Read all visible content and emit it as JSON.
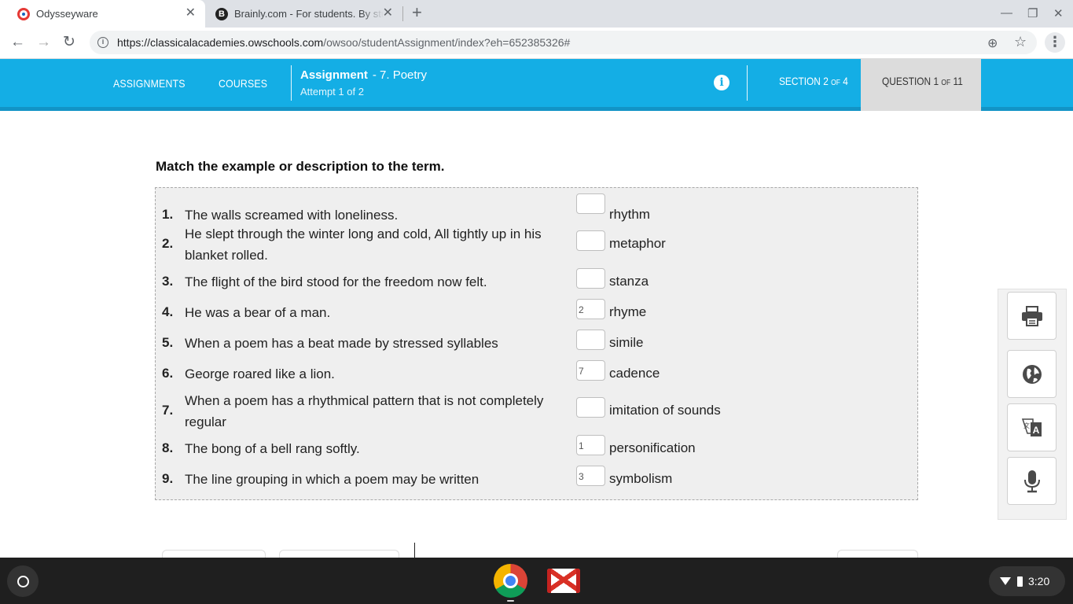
{
  "browser": {
    "tabs": [
      {
        "title": "Odysseyware"
      },
      {
        "title": "Brainly.com - For students. By students."
      }
    ],
    "url_host": "https://classicalacademies.owschools.com",
    "url_path": "/owsoo/studentAssignment/index?eh=652385326#"
  },
  "header": {
    "nav": [
      "ASSIGNMENTS",
      "COURSES"
    ],
    "assignment_label": "Assignment",
    "assignment_name": "- 7. Poetry",
    "attempt": "Attempt 1 of 2",
    "section": {
      "prefix": "SECTION 2",
      "of": "OF",
      "total": "4"
    },
    "question": {
      "prefix": "QUESTION 1",
      "of": "OF",
      "total": "11"
    }
  },
  "question": {
    "prompt": "Match the example or description to the term.",
    "rows": [
      {
        "num": "1.",
        "example": "The walls screamed with loneliness.",
        "answer": "",
        "term": "rhythm"
      },
      {
        "num": "2.",
        "example": "He slept through the winter long and cold, All tightly up in his blanket rolled.",
        "answer": "",
        "term": "metaphor"
      },
      {
        "num": "3.",
        "example": "The flight of the bird stood for the freedom now felt.",
        "answer": "",
        "term": "stanza"
      },
      {
        "num": "4.",
        "example": "He was a bear of a man.",
        "answer": "2",
        "term": "rhyme"
      },
      {
        "num": "5.",
        "example": "When a poem has a beat made by stressed syllables",
        "answer": "",
        "term": "simile"
      },
      {
        "num": "6.",
        "example": "George roared like a lion.",
        "answer": "7",
        "term": "cadence"
      },
      {
        "num": "7.",
        "example": "When a poem has a rhythmical pattern that is not completely regular",
        "answer": "",
        "term": "imitation of sounds"
      },
      {
        "num": "8.",
        "example": "The bong of a bell rang softly.",
        "answer": "1",
        "term": "personification"
      },
      {
        "num": "9.",
        "example": "The line grouping in which a poem may be written",
        "answer": "3",
        "term": "symbolism"
      }
    ]
  },
  "tools": [
    "printer-icon",
    "globe-icon",
    "translate-icon",
    "microphone-icon"
  ],
  "shelf": {
    "time": "3:20"
  },
  "colors": {
    "brand": "#14aee5",
    "brand_dark": "#1294c6",
    "active_step": "#dcdcdc"
  }
}
